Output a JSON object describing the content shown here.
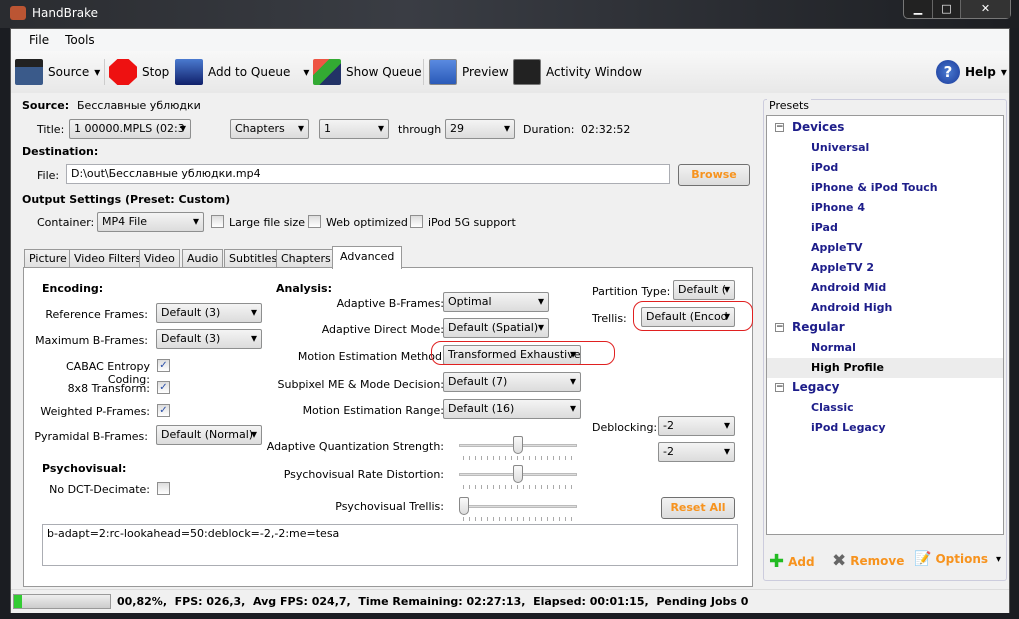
{
  "window": {
    "title": "HandBrake",
    "minimize": "▁",
    "maximize": "□",
    "close": "✕"
  },
  "menu": {
    "file": "File",
    "tools": "Tools"
  },
  "toolbar": {
    "source": "Source",
    "stop": "Stop",
    "add_to_queue": "Add to Queue",
    "show_queue": "Show Queue",
    "preview": "Preview",
    "activity_window": "Activity Window",
    "help": "Help"
  },
  "source": {
    "label": "Source:",
    "value": "Бесславные ублюдки",
    "title_label": "Title:",
    "title_value": "1 00000.MPLS (02:3",
    "range_type": "Chapters",
    "range_start": "1",
    "through": "through",
    "range_end": "29",
    "duration_label": "Duration:",
    "duration": "02:32:52"
  },
  "destination": {
    "heading": "Destination:",
    "file_label": "File:",
    "file_value": "D:\\out\\Бесславные ублюдки.mp4",
    "browse": "Browse"
  },
  "output": {
    "heading": "Output Settings (Preset: Custom)",
    "container_label": "Container:",
    "container_value": "MP4 File",
    "large_file": "Large file size",
    "web_optimized": "Web optimized",
    "ipod": "iPod 5G support"
  },
  "tabs": [
    "Picture",
    "Video Filters",
    "Video",
    "Audio",
    "Subtitles",
    "Chapters",
    "Advanced"
  ],
  "advanced": {
    "encoding_heading": "Encoding:",
    "reference_frames_label": "Reference Frames:",
    "reference_frames": "Default (3)",
    "max_bframes_label": "Maximum B-Frames:",
    "max_bframes": "Default (3)",
    "cabac_label": "CABAC Entropy Coding:",
    "transform_label": "8x8 Transform:",
    "weighted_label": "Weighted P-Frames:",
    "pyramidal_label": "Pyramidal B-Frames:",
    "pyramidal": "Default (Normal)",
    "psycho_heading": "Psychovisual:",
    "no_dct_label": "No DCT-Decimate:",
    "analysis_heading": "Analysis:",
    "adaptive_b_label": "Adaptive B-Frames:",
    "adaptive_b": "Optimal",
    "direct_label": "Adaptive Direct Mode:",
    "direct": "Default (Spatial)",
    "me_method_label": "Motion Estimation Method",
    "me_method": "Transformed Exhaustive",
    "subme_label": "Subpixel ME & Mode Decision:",
    "subme": "Default (7)",
    "me_range_label": "Motion Estimation Range:",
    "me_range": "Default (16)",
    "aq_label": "Adaptive Quantization Strength:",
    "aq_value": 0.5,
    "psy_rd_label": "Psychovisual Rate Distortion:",
    "psy_rd_value": 0.5,
    "psy_trellis_label": "Psychovisual Trellis:",
    "psy_trellis_value": 0,
    "partition_label": "Partition Type:",
    "partition": "Default (",
    "trellis_label": "Trellis:",
    "trellis": "Default (Encod",
    "deblocking_label": "Deblocking:",
    "deblock_a": "-2",
    "deblock_b": "-2",
    "reset_all": "Reset All",
    "options_string": "b-adapt=2:rc-lookahead=50:deblock=-2,-2:me=tesa"
  },
  "presets": {
    "heading": "Presets",
    "groups": [
      {
        "name": "Devices",
        "items": [
          "Universal",
          "iPod",
          "iPhone & iPod Touch",
          "iPhone 4",
          "iPad",
          "AppleTV",
          "AppleTV 2",
          "Android Mid",
          "Android High"
        ]
      },
      {
        "name": "Regular",
        "items": [
          "Normal",
          "High Profile"
        ]
      },
      {
        "name": "Legacy",
        "items": [
          "Classic",
          "iPod Legacy"
        ]
      }
    ],
    "selected": "High Profile",
    "add": "Add",
    "remove": "Remove",
    "options": "Options"
  },
  "status": {
    "progress_percent": 0.82,
    "text": "00,82%,  FPS: 026,3,  Avg FPS: 024,7,  Time Remaining: 02:27:13,  Elapsed: 00:01:15,  Pending Jobs 0"
  }
}
